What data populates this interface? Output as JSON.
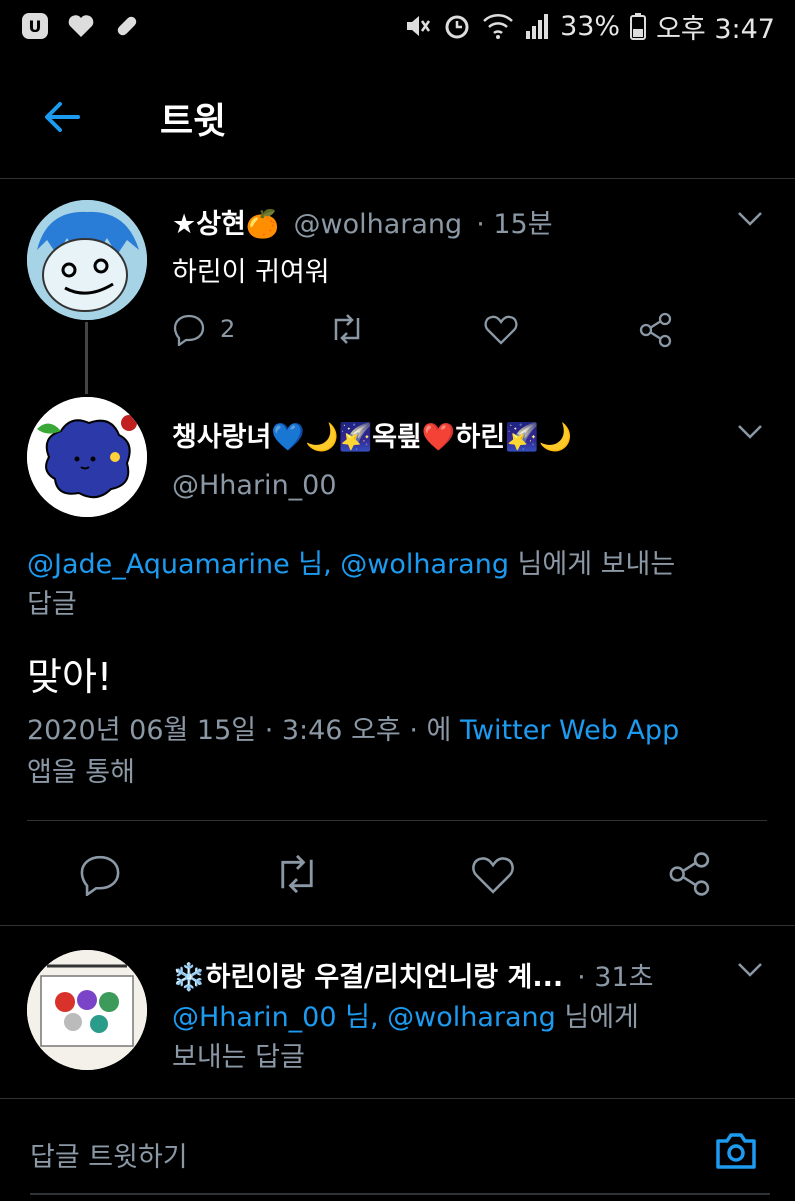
{
  "status_bar": {
    "battery": "33%",
    "time": "오후 3:47"
  },
  "header": {
    "title": "트윗"
  },
  "parent_tweet": {
    "name": "★상현🍊",
    "handle": "@wolharang",
    "time": "· 15분",
    "text": "하린이 귀여워",
    "reply_count": "2"
  },
  "main_tweet": {
    "name": "챙사랑녀💙🌙🌠옥릪❤️하린🌠🌙",
    "handle": "@Hharin_00",
    "reply_to_users": "@Jade_Aquamarine 님, @wolharang",
    "reply_to_suffix": " 님에게 보내는",
    "reply_to_line2": "답글",
    "text": "맞아!",
    "meta_date": "2020년 06월 15일 · 3:46 오후 · 에 ",
    "meta_app": "Twitter Web App",
    "meta_suffix": "앱을 통해"
  },
  "reply_tweet": {
    "name": "❄️하린이랑 우결/리치언니랑 계...",
    "time": "· 31초",
    "reply_to_users": "@Hharin_00 님, @wolharang",
    "reply_to_suffix": " 님에게",
    "reply_to_line2": "보내는 답글"
  },
  "compose": {
    "placeholder": "답글 트윗하기"
  },
  "colors": {
    "accent": "#1d9bf0",
    "muted": "#8b98a5",
    "like_red": "#e0245e"
  }
}
